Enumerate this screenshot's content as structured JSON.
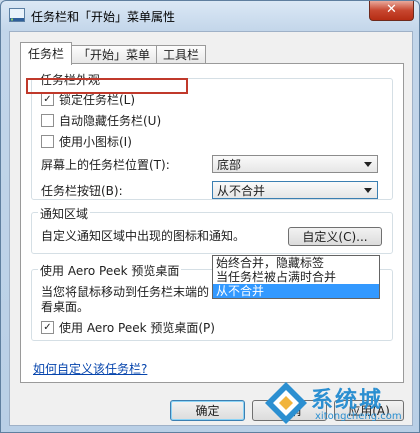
{
  "window": {
    "title": "任务栏和「开始」菜单属性",
    "close_label": "✕"
  },
  "tabs": [
    {
      "label": "任务栏",
      "active": true
    },
    {
      "label": "「开始」菜单",
      "active": false
    },
    {
      "label": "工具栏",
      "active": false
    }
  ],
  "appearance": {
    "legend": "任务栏外观",
    "lock": {
      "label": "锁定任务栏(L)",
      "checked": true,
      "mark": "✓"
    },
    "autohide": {
      "label": "自动隐藏任务栏(U)",
      "checked": false,
      "mark": ""
    },
    "small_icons": {
      "label": "使用小图标(I)",
      "checked": false,
      "mark": ""
    },
    "position_label": "屏幕上的任务栏位置(T):",
    "position_value": "底部",
    "buttons_label": "任务栏按钮(B):",
    "buttons_value": "从不合并",
    "dropdown_options": [
      {
        "label": "始终合并，隐藏标签",
        "selected": false
      },
      {
        "label": "当任务栏被占满时合并",
        "selected": false
      },
      {
        "label": "从不合并",
        "selected": true
      }
    ]
  },
  "notification": {
    "legend": "通知区域",
    "description": "自定义通知区域中出现的图标和通知。",
    "customize_button": "自定义(C)..."
  },
  "aero_peek": {
    "legend": "使用 Aero Peek 预览桌面",
    "description": "当您将鼠标移动到任务栏末端的 \"显示桌面\" 按钮时，会暂时查看桌面。",
    "checkbox": {
      "label": "使用 Aero Peek 预览桌面(P)",
      "checked": true,
      "mark": "✓"
    }
  },
  "help_link": "如何自定义该任务栏?",
  "buttons": {
    "ok": "确定",
    "cancel": "取消",
    "apply": "应用(A)"
  },
  "watermark": {
    "text": "系统城",
    "url": "xitongcheng.com"
  },
  "colors": {
    "accent": "#3399ff",
    "highlight_border": "#c0392b",
    "link": "#0645ad"
  }
}
